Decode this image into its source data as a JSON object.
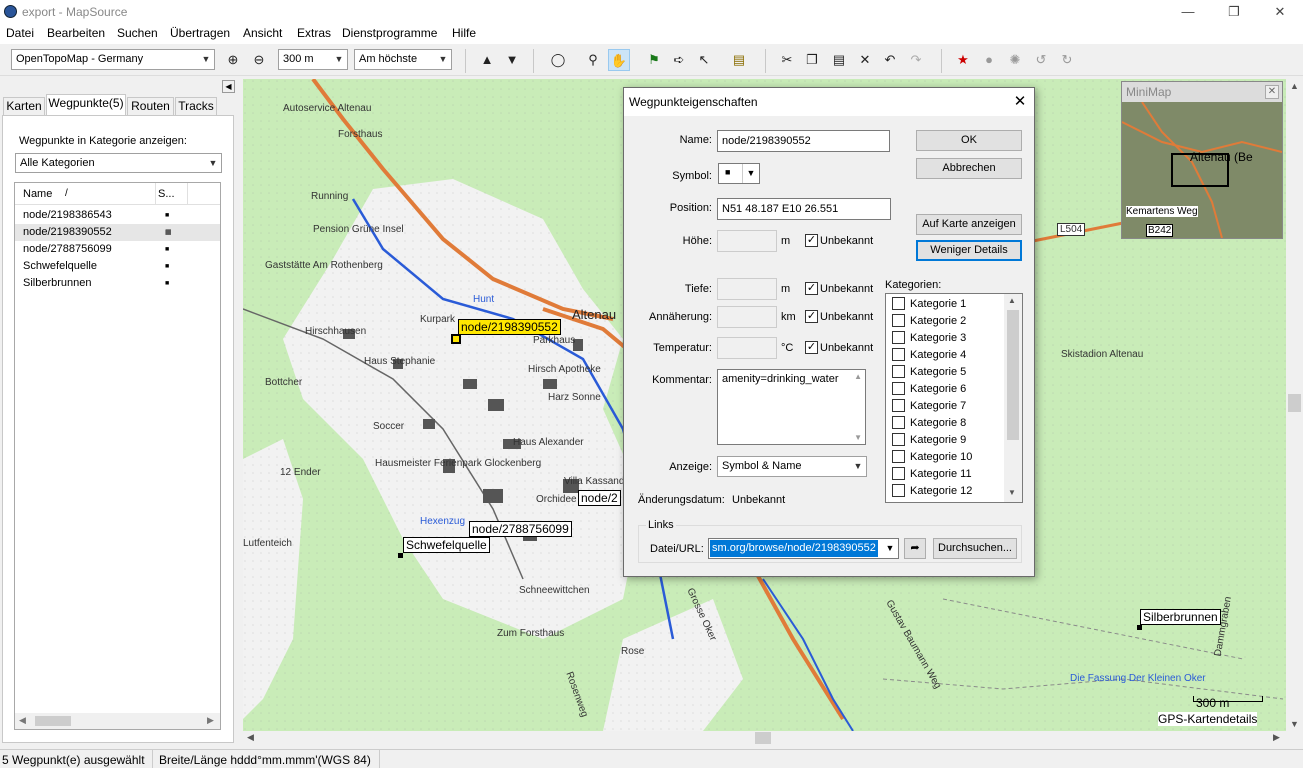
{
  "window": {
    "title": "export - MapSource"
  },
  "menu": [
    "Datei",
    "Bearbeiten",
    "Suchen",
    "Übertragen",
    "Ansicht",
    "Extras",
    "Dienstprogramme",
    "Hilfe"
  ],
  "toolbar": {
    "map_product": "OpenTopoMap - Germany",
    "zoom_scale": "300 m",
    "detail_level": "Am höchste"
  },
  "tabs": [
    "Karten",
    "Wegpunkte(5)",
    "Routen",
    "Tracks"
  ],
  "waypoints_panel": {
    "category_label": "Wegpunkte in Kategorie anzeigen:",
    "category_value": "Alle Kategorien",
    "col_name": "Name",
    "col_sort": "/",
    "col_symbol": "S...",
    "items": [
      {
        "name": "node/2198386543",
        "symbol": "■"
      },
      {
        "name": "node/2198390552",
        "symbol": "▦"
      },
      {
        "name": "node/2788756099",
        "symbol": "■"
      },
      {
        "name": "Schwefelquelle",
        "symbol": "■"
      },
      {
        "name": "Silberbrunnen",
        "symbol": "■"
      }
    ]
  },
  "map": {
    "labels": [
      "Autoservice Altenau",
      "Forsthaus",
      "Running",
      "Pension Grüne Insel",
      "Gaststätte Am Rothenberg",
      "Hirschhausen",
      "Kurpark",
      "Haus Stephanie",
      "Parkhaus",
      "Hirsch Apotheke",
      "Bottcher",
      "Harz Sonne",
      "Haus Alexander",
      "Hausmeister Ferienpark Glockenberg",
      "12 Ender",
      "Soccer",
      "Villa Kassandra",
      "Orchidee",
      "Hexenzug",
      "Schneewittchen",
      "Zum Forsthaus",
      "Rose",
      "Skistadion Altenau",
      "Dammgraben",
      "Die Fassung Der Kleinen Oker",
      "Altenau",
      "L504",
      "B242",
      "Hunt",
      "Lutfenteich",
      "Grosse Oker",
      "Gustav Baumann Weg",
      "Rosenweg"
    ],
    "waypoint_labels": {
      "selected": "node/2198390552",
      "w2": "node/2788756099",
      "w3": "Schwefelquelle",
      "w4": "Silberbrunnen",
      "w5": "node/2"
    },
    "scale_label": "300 m",
    "details_label": "GPS-Kartendetails"
  },
  "minimap": {
    "title": "MiniMap",
    "labels": [
      "Altenau (Be",
      "Kemartens Weg",
      "B242"
    ]
  },
  "dialog": {
    "title": "Wegpunkteigenschaften",
    "name_label": "Name:",
    "name_value": "node/2198390552",
    "symbol_label": "Symbol:",
    "position_label": "Position:",
    "position_value": "N51 48.187 E10 26.551",
    "hoehe_label": "Höhe:",
    "hoehe_unit": "m",
    "tiefe_label": "Tiefe:",
    "tiefe_unit": "m",
    "annaeherung_label": "Annäherung:",
    "annaeherung_unit": "km",
    "temperatur_label": "Temperatur:",
    "temperatur_unit": "°C",
    "unbekannt": "Unbekannt",
    "kommentar_label": "Kommentar:",
    "kommentar_value": "amenity=drinking_water",
    "anzeige_label": "Anzeige:",
    "anzeige_value": "Symbol & Name",
    "aenderung_label": "Änderungsdatum:",
    "aenderung_value": "Unbekannt",
    "kategorien_label": "Kategorien:",
    "kategorien": [
      "Kategorie 1",
      "Kategorie 2",
      "Kategorie 3",
      "Kategorie 4",
      "Kategorie 5",
      "Kategorie 6",
      "Kategorie 7",
      "Kategorie 8",
      "Kategorie 9",
      "Kategorie 10",
      "Kategorie 11",
      "Kategorie 12"
    ],
    "ok": "OK",
    "abbrechen": "Abbrechen",
    "auf_karte": "Auf Karte anzeigen",
    "weniger": "Weniger Details",
    "links_label": "Links",
    "datei_label": "Datei/URL:",
    "url_value": "sm.org/browse/node/2198390552",
    "durchsuchen": "Durchsuchen..."
  },
  "status": {
    "selection": "5 Wegpunkt(e) ausgewählt",
    "coord_format": "Breite/Länge hddd°mm.mmm'(WGS 84)"
  }
}
